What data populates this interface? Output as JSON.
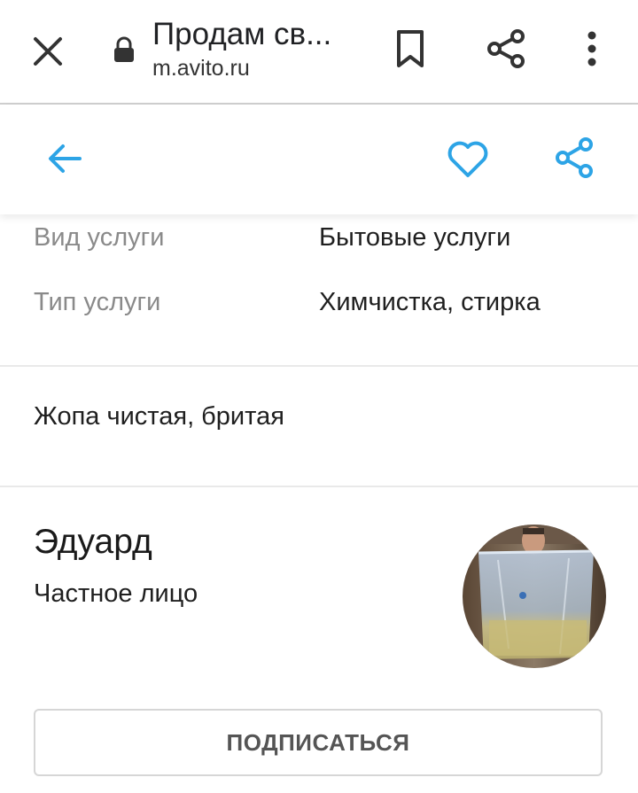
{
  "browser": {
    "title": "Продам св...",
    "url": "m.avito.ru",
    "icons": [
      "close-icon",
      "lock-icon",
      "bookmark-icon",
      "share-icon",
      "more-vert-icon"
    ]
  },
  "header": {
    "accent_color": "#2da4e6",
    "icons": [
      "arrow-left-icon",
      "heart-icon",
      "share-icon"
    ]
  },
  "params": [
    {
      "label": "Вид услуги",
      "value": "Бытовые услуги"
    },
    {
      "label": "Тип услуги",
      "value": "Химчистка, стирка"
    }
  ],
  "description": "Жопа чистая, бритая",
  "seller": {
    "name": "Эдуард",
    "type": "Частное лицо"
  },
  "subscribe_label": "ПОДПИСАТЬСЯ"
}
